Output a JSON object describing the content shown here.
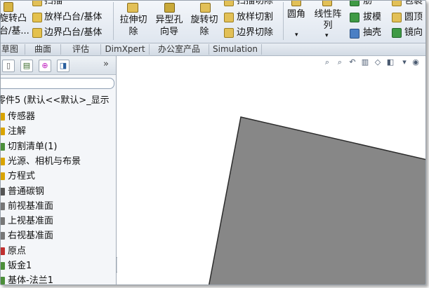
{
  "ribbon": {
    "col1": {
      "top": "旋转凸",
      "bottom": "台/基..."
    },
    "col2": [
      {
        "label": "扫描",
        "icon": "sweep-icon"
      },
      {
        "label": "放样凸台/基体",
        "icon": "loft-boss-icon"
      },
      {
        "label": "边界凸台/基体",
        "icon": "boundary-boss-icon"
      }
    ],
    "extrude_cut": {
      "line1": "拉伸切",
      "line2": "除"
    },
    "hole_wizard": {
      "line1": "异型孔",
      "line2": "向导"
    },
    "revolve_cut": {
      "line1": "旋转切",
      "line2": "除"
    },
    "col6": [
      {
        "label": "扫描切除",
        "icon": "sweep-cut-icon"
      },
      {
        "label": "放样切割",
        "icon": "loft-cut-icon"
      },
      {
        "label": "边界切除",
        "icon": "boundary-cut-icon"
      }
    ],
    "fillet": {
      "label": "圆角"
    },
    "linear_pattern": {
      "line1": "线性阵",
      "line2": "列"
    },
    "col9": [
      {
        "label": "筋",
        "icon": "rib-icon"
      },
      {
        "label": "拔模",
        "icon": "draft-icon"
      },
      {
        "label": "抽壳",
        "icon": "shell-icon"
      }
    ],
    "col10": [
      {
        "label": "包裹",
        "icon": "wrap-icon"
      },
      {
        "label": "圆顶",
        "icon": "dome-icon"
      },
      {
        "label": "镜向",
        "icon": "mirror-icon"
      }
    ]
  },
  "tabs": [
    "草图",
    "曲面",
    "评估",
    "DimXpert",
    "办公室产品",
    "Simulation"
  ],
  "panel": {
    "expand_glyph": "»",
    "root_label": "零件5 (默认<<默认>_显示",
    "items": [
      {
        "label": "传感器",
        "icon": "sensor-icon",
        "color": "#d9a400"
      },
      {
        "label": "注解",
        "icon": "annotation-icon",
        "color": "#d9a400"
      },
      {
        "label": "切割清单(1)",
        "icon": "cut-list-icon",
        "color": "#4c8f3a"
      },
      {
        "label": "光源、相机与布景",
        "icon": "lights-cameras-icon",
        "color": "#d9a400"
      },
      {
        "label": "方程式",
        "icon": "equations-icon",
        "color": "#d9a400"
      },
      {
        "label": "普通碳钢",
        "icon": "material-icon",
        "color": "#555555"
      },
      {
        "label": "前视基准面",
        "icon": "plane-icon",
        "color": "#777777"
      },
      {
        "label": "上视基准面",
        "icon": "plane-icon",
        "color": "#777777"
      },
      {
        "label": "右视基准面",
        "icon": "plane-icon",
        "color": "#777777"
      },
      {
        "label": "原点",
        "icon": "origin-icon",
        "color": "#c03030"
      },
      {
        "label": "钣金1",
        "icon": "sheet-metal-icon",
        "color": "#4c8f3a"
      },
      {
        "label": "基体-法兰1",
        "icon": "base-flange-icon",
        "color": "#4c8f3a"
      }
    ]
  },
  "colors": {
    "shape_fill": "#878787",
    "shape_stroke": "#2b2b2b",
    "ribbon_bg": "#e6ecf2"
  }
}
